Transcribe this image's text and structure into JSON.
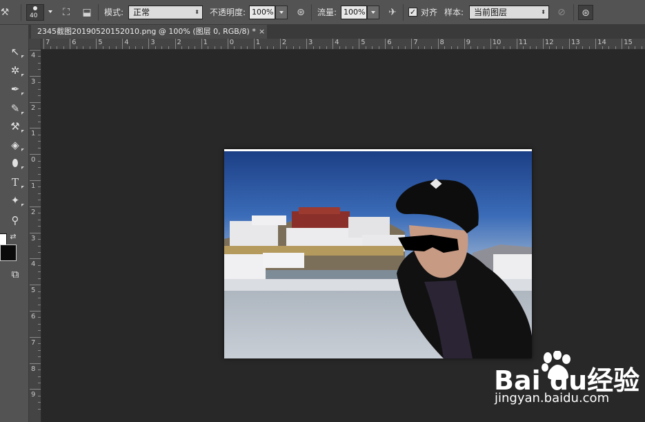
{
  "options_bar": {
    "brush_size": "40",
    "mode_label": "模式:",
    "mode_value": "正常",
    "opacity_label": "不透明度:",
    "opacity_value": "100%",
    "flow_label": "流量:",
    "flow_value": "100%",
    "align_label": "对齐",
    "align_checked": true,
    "sample_label": "样本:",
    "sample_value": "当前图层"
  },
  "document_tab": {
    "title": "2345截图20190520152010.png @ 100% (图层 0, RGB/8) *",
    "close": "×"
  },
  "rulers": {
    "horizontal": [
      "7",
      "6",
      "5",
      "4",
      "3",
      "2",
      "1",
      "0",
      "1",
      "2",
      "3",
      "4",
      "5",
      "6",
      "7",
      "8",
      "9",
      "10",
      "11",
      "12",
      "13",
      "14",
      "15"
    ],
    "vertical": [
      "4",
      "3",
      "2",
      "1",
      "0",
      "1",
      "2",
      "3",
      "4",
      "5",
      "6",
      "7",
      "8",
      "9"
    ]
  },
  "tools": [
    {
      "name": "move-tool",
      "glyph": "↖"
    },
    {
      "name": "magic-wand-tool",
      "glyph": "✲"
    },
    {
      "name": "eyedropper-tool",
      "glyph": "✒"
    },
    {
      "name": "brush-tool",
      "glyph": "🖌"
    },
    {
      "name": "clone-stamp-tool",
      "glyph": "⚒"
    },
    {
      "name": "paint-bucket-tool",
      "glyph": "◈"
    },
    {
      "name": "smudge-tool",
      "glyph": "⬮"
    },
    {
      "name": "type-tool",
      "glyph": "T"
    },
    {
      "name": "custom-shape-tool",
      "glyph": "✦"
    },
    {
      "name": "zoom-tool",
      "glyph": "⚲"
    }
  ],
  "colors": {
    "foreground": "#ffffff",
    "background": "#0a0a0a",
    "ui_panel": "#535353",
    "workspace": "#282828"
  },
  "watermark": {
    "brand": "Bai du经验",
    "url": "jingyan.baidu.com"
  }
}
